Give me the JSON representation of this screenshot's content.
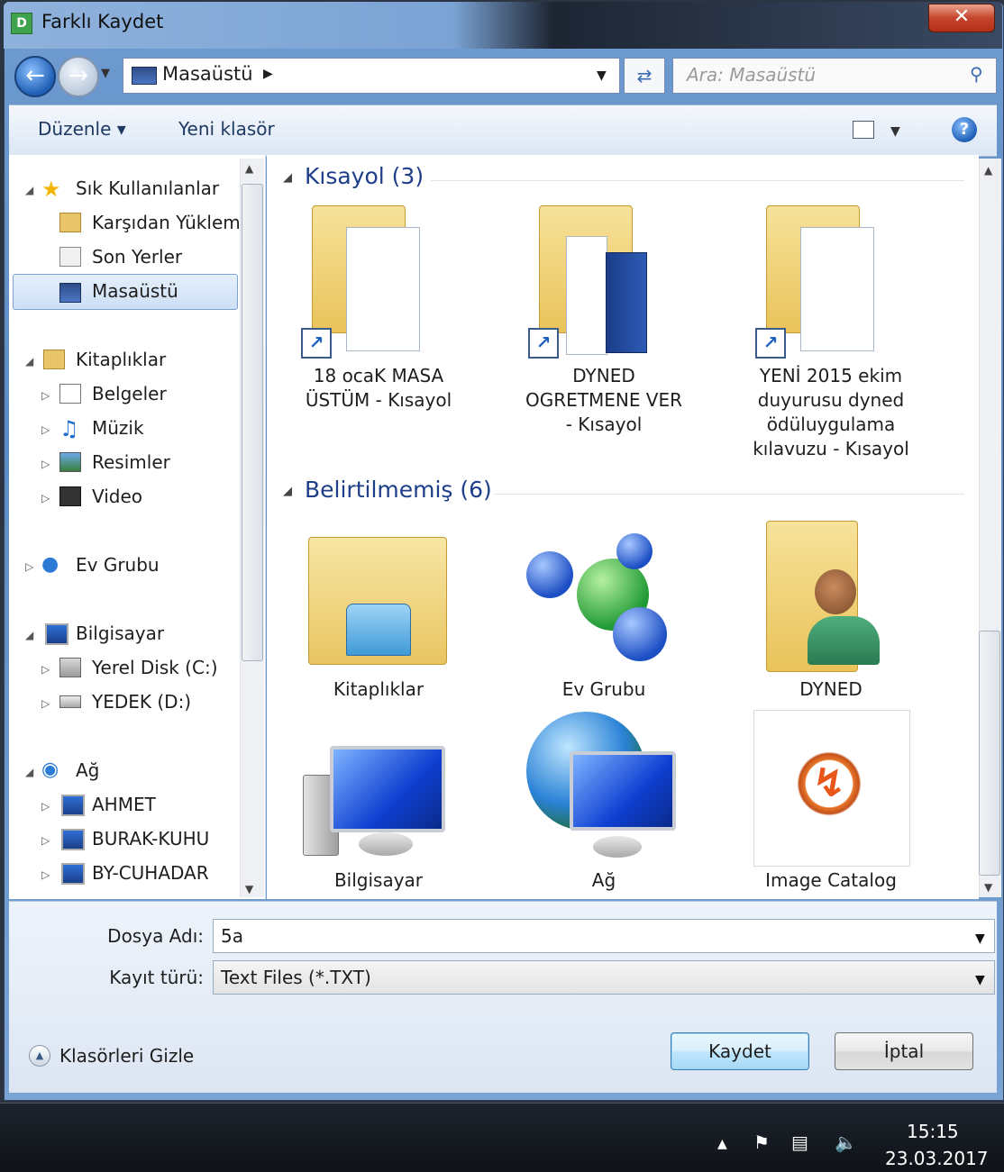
{
  "window": {
    "title": "Farklı Kaydet",
    "app_icon": "D",
    "close_label": "✕"
  },
  "address": {
    "path": "Masaüstü",
    "search_placeholder": "Ara: Masaüstü"
  },
  "toolbar": {
    "organize": "Düzenle ▾",
    "new_folder": "Yeni klasör",
    "help": "?"
  },
  "nav": {
    "favorites": "Sık Kullanılanlar",
    "downloads": "Karşıdan Yüklem",
    "recent": "Son Yerler",
    "desktop": "Masaüstü",
    "libraries": "Kitaplıklar",
    "documents": "Belgeler",
    "music": "Müzik",
    "pictures": "Resimler",
    "video": "Video",
    "homegroup": "Ev Grubu",
    "computer": "Bilgisayar",
    "drive_c": "Yerel Disk (C:)",
    "drive_d": "YEDEK (D:)",
    "network": "Ağ",
    "pc1": "AHMET",
    "pc2": "BURAK-KUHU",
    "pc3": "BY-CUHADAR"
  },
  "groups": {
    "shortcuts": "Kısayol (3)",
    "unspecified": "Belirtilmemiş (6)"
  },
  "files": {
    "f1": [
      "18 ocaK MASA",
      "ÜSTÜM - Kısayol"
    ],
    "f2": [
      "DYNED",
      "OGRETMENE VER",
      "- Kısayol"
    ],
    "f3": [
      "YENİ 2015 ekim",
      "duyurusu dyned",
      "ödüluygulama",
      "kılavuzu - Kısayol"
    ],
    "i1": "Kitaplıklar",
    "i2": "Ev Grubu",
    "i3": "DYNED",
    "i4": "Bilgisayar",
    "i5": "Ağ",
    "i6": "Image Catalog"
  },
  "form": {
    "filename_label": "Dosya Adı:",
    "filename_value": "5a",
    "type_label": "Kayıt türü:",
    "type_value": "Text Files (*.TXT)",
    "save": "Kaydet",
    "cancel": "İptal",
    "hide_folders": "Klasörleri Gizle"
  },
  "taskbar": {
    "time": "15:15",
    "date": "23.03.2017"
  },
  "colors": {
    "accent": "#1e3e8a",
    "selection": "#cddff5",
    "title_bar": "#7ba3d4",
    "close": "#c6452d"
  }
}
